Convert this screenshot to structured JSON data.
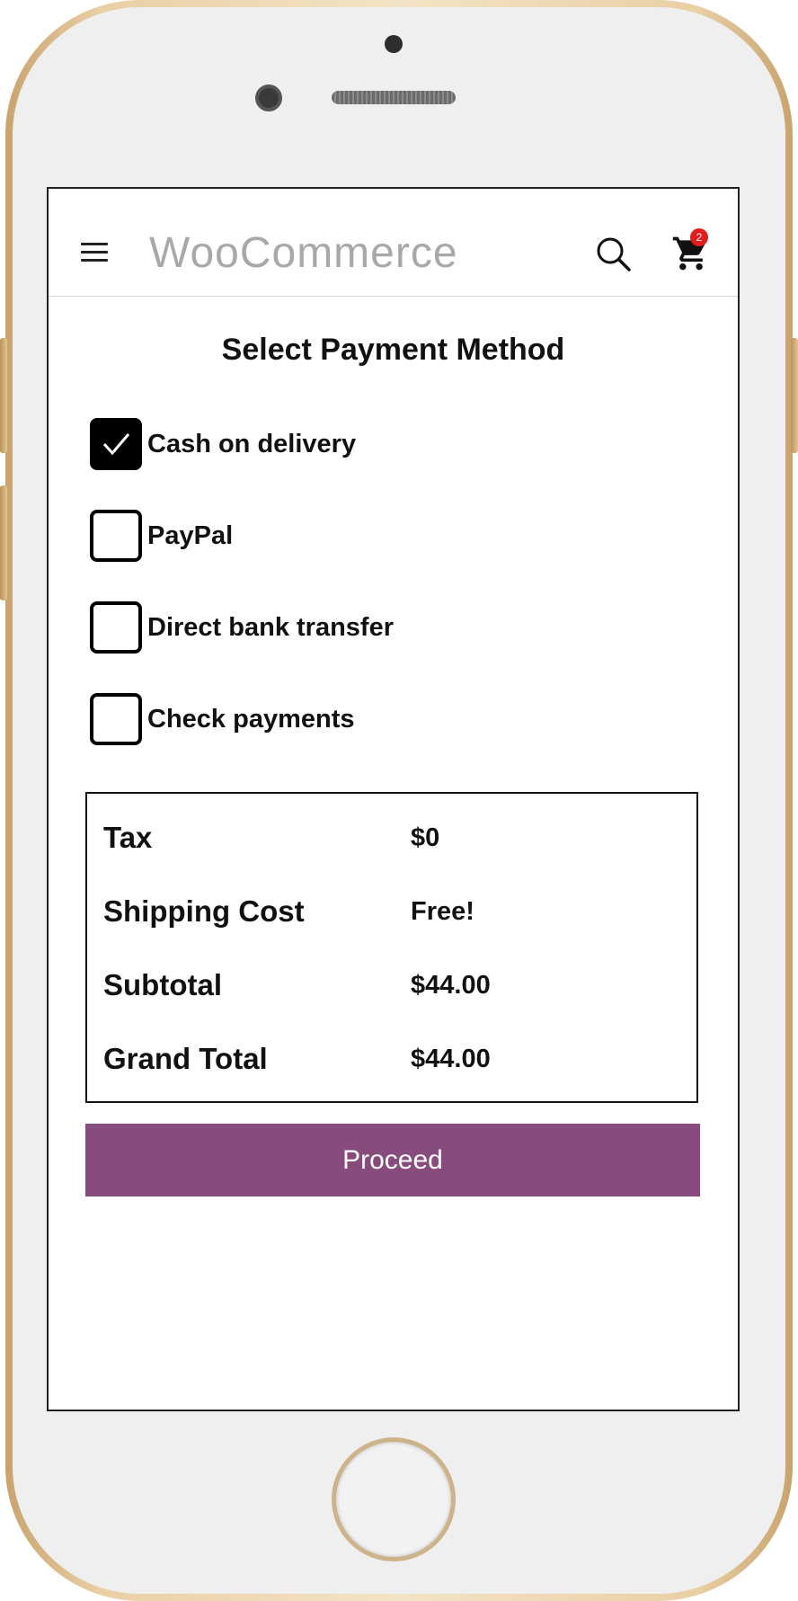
{
  "header": {
    "app_title": "WooCommerce",
    "cart_count": "2",
    "icons": [
      "menu-icon",
      "search-icon",
      "cart-icon"
    ]
  },
  "page": {
    "title": "Select Payment Method"
  },
  "payment_methods": [
    {
      "label": "Cash on delivery",
      "checked": true
    },
    {
      "label": "PayPal",
      "checked": false
    },
    {
      "label": "Direct bank transfer",
      "checked": false
    },
    {
      "label": "Check payments",
      "checked": false
    }
  ],
  "summary": [
    {
      "label": "Tax",
      "value": "$0"
    },
    {
      "label": "Shipping Cost",
      "value": "Free!"
    },
    {
      "label": "Subtotal",
      "value": "$44.00"
    },
    {
      "label": "Grand Total",
      "value": "$44.00"
    }
  ],
  "actions": {
    "proceed_label": "Proceed"
  },
  "colors": {
    "accent": "#874b7e",
    "badge": "#e11d1d",
    "title_gray": "#a8a8a8"
  }
}
